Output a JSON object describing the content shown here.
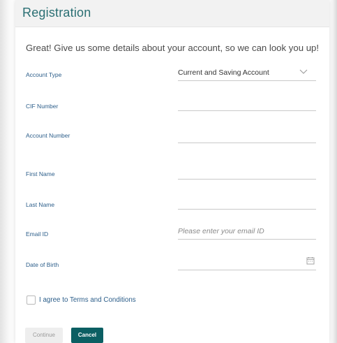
{
  "header": {
    "title": "Registration"
  },
  "intro": "Great! Give us some details about your account, so we can look you up!",
  "form": {
    "account_type": {
      "label": "Account Type",
      "value": "Current and Saving Account"
    },
    "cif_number": {
      "label": "CIF Number",
      "value": ""
    },
    "account_number": {
      "label": "Account Number",
      "value": ""
    },
    "first_name": {
      "label": "First Name",
      "value": ""
    },
    "last_name": {
      "label": "Last Name",
      "value": ""
    },
    "email": {
      "label": "Email ID",
      "placeholder": "Please enter your email ID"
    },
    "dob": {
      "label": "Date of Birth",
      "value": ""
    },
    "terms": {
      "label": "I agree to Terms and Conditions",
      "checked": false
    }
  },
  "buttons": {
    "continue": "Continue",
    "cancel": "Cancel"
  },
  "icons": {
    "dropdown": "chevron-down-icon",
    "calendar": "calendar-icon"
  },
  "colors": {
    "title": "#2a6f73",
    "label": "#2c5e8a",
    "primary_button": "#0b5f63"
  }
}
